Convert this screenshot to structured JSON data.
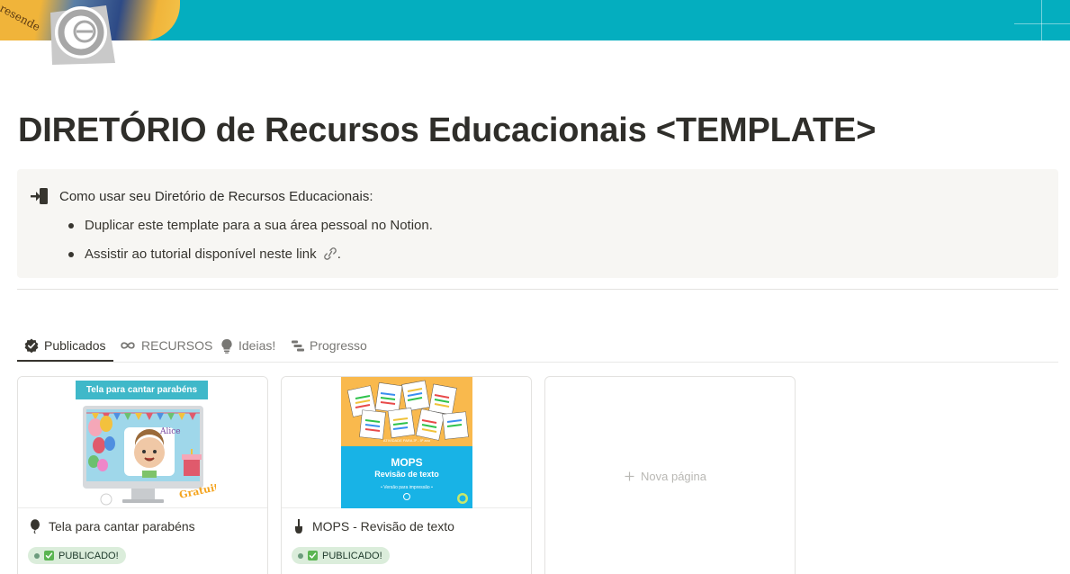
{
  "cover": {
    "text": "resende"
  },
  "page": {
    "title": "DIRETÓRIO de Recursos Educacionais <TEMPLATE>",
    "icon": "circle-e-logo-icon"
  },
  "callout": {
    "icon": "sign-in-door-icon",
    "heading": "Como usar seu Diretório de Recursos Educacionais:",
    "items": [
      {
        "text": "Duplicar este template para a sua área pessoal no Notion."
      },
      {
        "text": "Assistir ao tutorial disponível neste link",
        "link_icon": "link-icon",
        "suffix": "."
      }
    ]
  },
  "tabs": [
    {
      "label": "Publicados",
      "icon": "verified-badge-icon",
      "active": true
    },
    {
      "label": "RECURSOS",
      "icon": "infinity-icon",
      "active": false
    },
    {
      "label": "Ideias!",
      "icon": "lightbulb-icon",
      "active": false
    },
    {
      "label": "Progresso",
      "icon": "timeline-icon",
      "active": false
    }
  ],
  "cards": [
    {
      "title": "Tela para cantar parabéns",
      "icon": "balloon-icon",
      "status": "PUBLICADO!",
      "cover": {
        "header": "Tela para cantar parabéns",
        "name_tag": "Alice",
        "ribbon": "Gratuito"
      }
    },
    {
      "title": "MOPS - Revisão de texto",
      "icon": "brush-icon",
      "status": "PUBLICADO!",
      "cover": {
        "small_text": "ATIVIDADE PARA 3º - 5º ano",
        "title": "MOPS",
        "subtitle": "Revisão de texto",
        "tiny_text": "• Versão para impressão •"
      }
    }
  ],
  "new_page_label": "Nova página",
  "colors": {
    "cover_teal": "#04aebf",
    "callout_bg": "#f7f6f3",
    "badge_bg": "#dbeddb",
    "text": "#37352f"
  }
}
